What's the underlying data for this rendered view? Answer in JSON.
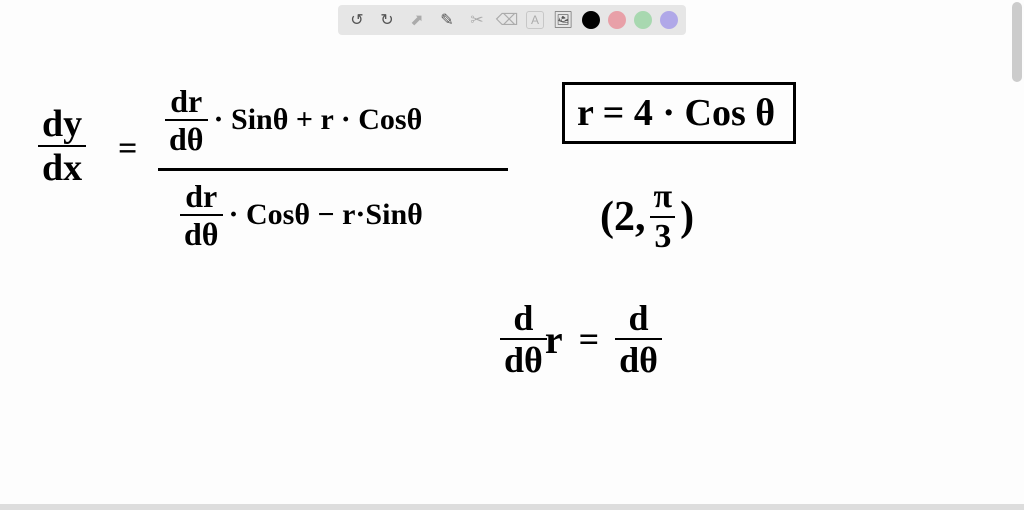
{
  "toolbar": {
    "undo": "↺",
    "redo": "↻",
    "pointer": "⬈",
    "pen": "✎",
    "tools": "✂",
    "eraser": "⌫",
    "text": "A",
    "image": "🖼"
  },
  "math": {
    "dydx_num": "dy",
    "dydx_den": "dx",
    "equals": "=",
    "drdtheta_num": "dr",
    "drdtheta_den": "dθ",
    "top_rest": "· Sinθ  +  r · Cosθ",
    "bot_rest": "· Cosθ − r·Sinθ",
    "boxed": "r = 4 · Cos θ",
    "point_open": "(2,",
    "pi": "π",
    "three": "3",
    "point_close": ")",
    "ddtheta_num": "d",
    "ddtheta_den": "dθ",
    "r_var": "r",
    "eq2": "=",
    "ddtheta2_num": "d",
    "ddtheta2_den": "dθ"
  }
}
